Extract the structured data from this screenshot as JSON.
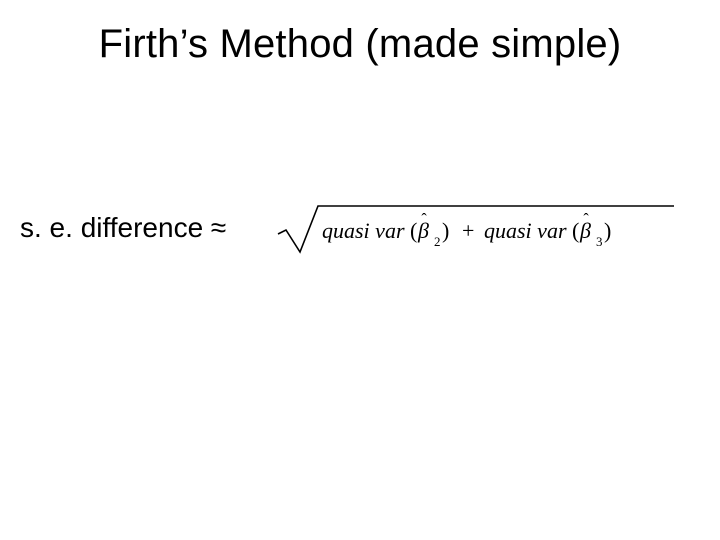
{
  "slide": {
    "title": "Firth’s Method (made simple)",
    "se_label": "s. e. difference ≈",
    "formula": {
      "term1_func": "quasi var",
      "term1_symbol": "β",
      "term1_hat": "ˆ",
      "term1_sub": "2",
      "plus": "+",
      "term2_func": "quasi var",
      "term2_symbol": "β",
      "term2_hat": "ˆ",
      "term2_sub": "3"
    }
  }
}
